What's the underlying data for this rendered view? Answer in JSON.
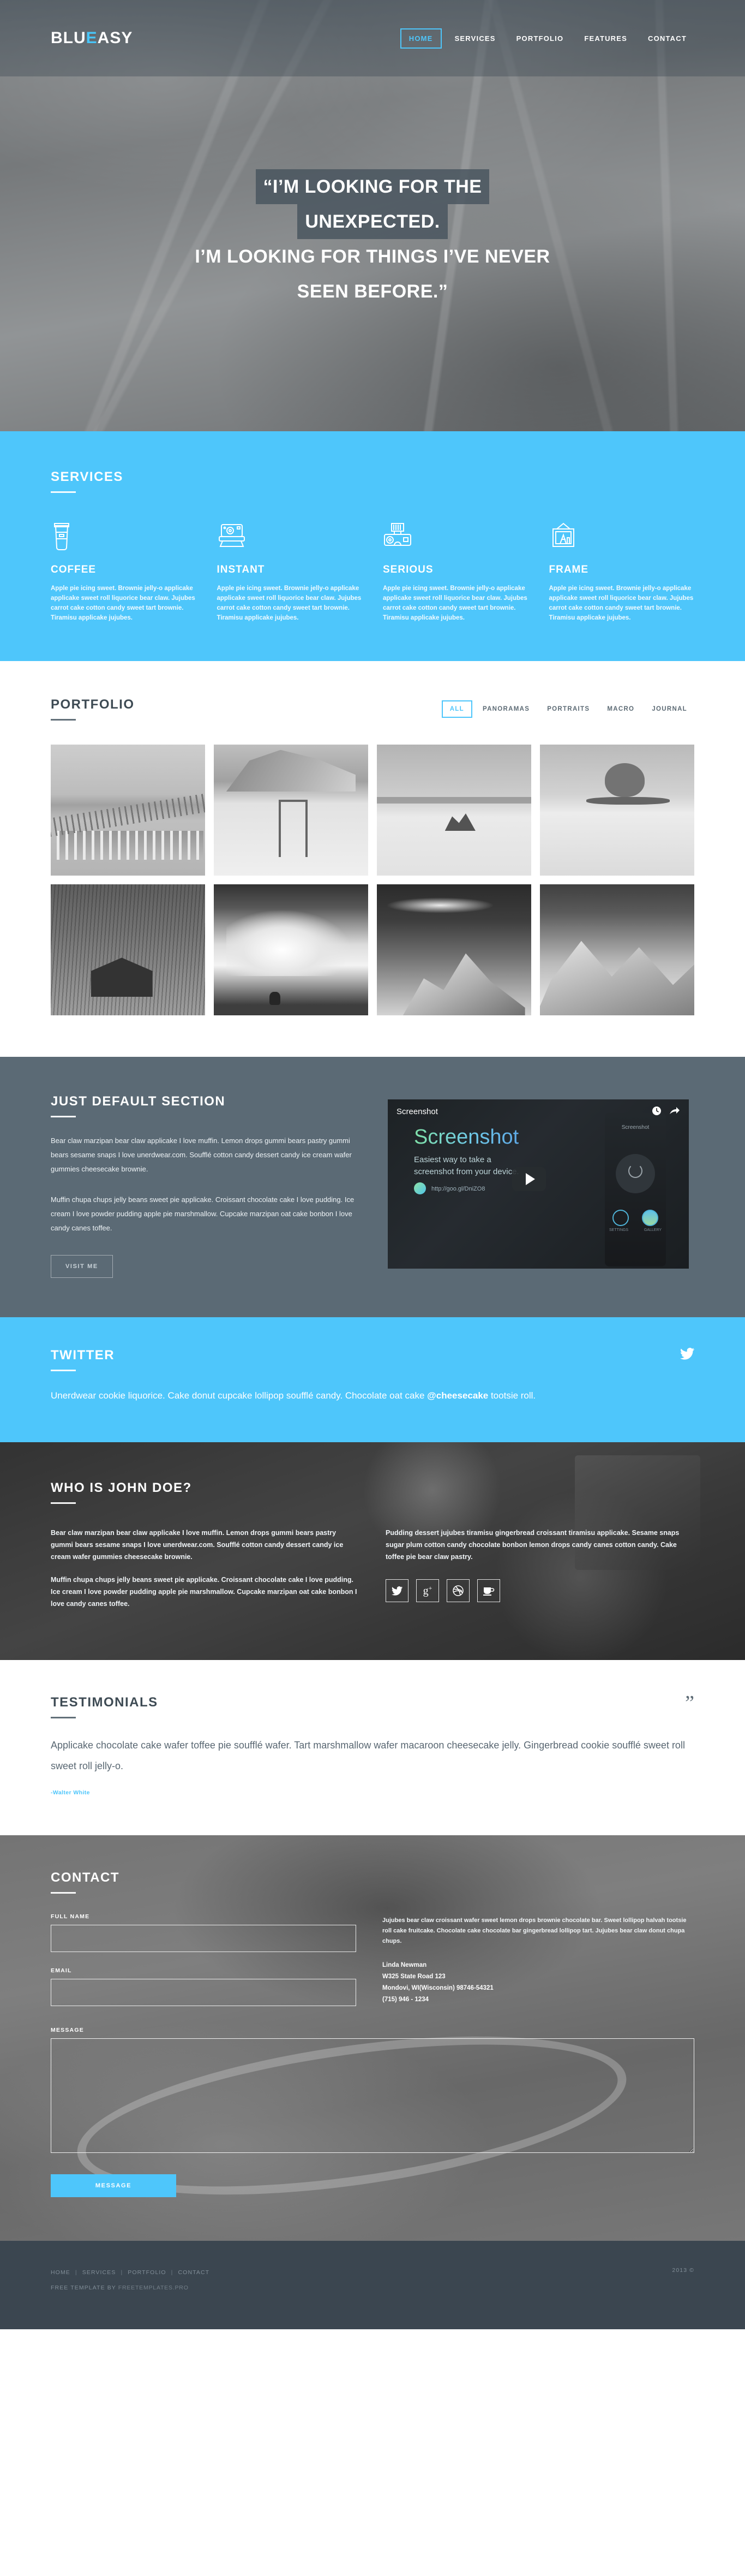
{
  "brand": {
    "prefix": "BLU",
    "highlight": "E",
    "suffix": "ASY",
    "accent": "#4ec6fb"
  },
  "nav": {
    "items": [
      {
        "label": "HOME",
        "active": true
      },
      {
        "label": "SERVICES",
        "active": false
      },
      {
        "label": "PORTFOLIO",
        "active": false
      },
      {
        "label": "FEATURES",
        "active": false
      },
      {
        "label": "CONTACT",
        "active": false
      }
    ]
  },
  "hero": {
    "line1": "“I’M LOOKING FOR THE",
    "line2": "UNEXPECTED.",
    "line3": "I’M LOOKING FOR THINGS I’VE NEVER",
    "line4": "SEEN BEFORE.”"
  },
  "services": {
    "title": "SERVICES",
    "items": [
      {
        "icon": "coffee-cup-icon",
        "title": "COFFEE",
        "body": "Apple pie icing sweet. Brownie jelly-o applicake applicake sweet roll liquorice bear claw. Jujubes carrot cake cotton candy sweet tart brownie. Tiramisu applicake jujubes."
      },
      {
        "icon": "instant-camera-icon",
        "title": "INSTANT",
        "body": "Apple pie icing sweet. Brownie jelly-o applicake applicake sweet roll liquorice bear claw. Jujubes carrot cake cotton candy sweet tart brownie. Tiramisu applicake jujubes."
      },
      {
        "icon": "dslr-camera-icon",
        "title": "SERIOUS",
        "body": "Apple pie icing sweet. Brownie jelly-o applicake applicake sweet roll liquorice bear claw. Jujubes carrot cake cotton candy sweet tart brownie. Tiramisu applicake jujubes."
      },
      {
        "icon": "picture-frame-icon",
        "title": "FRAME",
        "body": "Apple pie icing sweet. Brownie jelly-o applicake applicake sweet roll liquorice bear claw. Jujubes carrot cake cotton candy sweet tart brownie. Tiramisu applicake jujubes."
      }
    ]
  },
  "portfolio": {
    "title": "PORTFOLIO",
    "filters": [
      {
        "label": "ALL",
        "active": true
      },
      {
        "label": "PANORAMAS",
        "active": false
      },
      {
        "label": "PORTRAITS",
        "active": false
      },
      {
        "label": "MACRO",
        "active": false
      },
      {
        "label": "JOURNAL",
        "active": false
      }
    ],
    "items": [
      {
        "name": "curved-pier-over-water",
        "style": "ph-pier"
      },
      {
        "name": "golden-gate-bridge-in-fog",
        "style": "ph-bridge"
      },
      {
        "name": "lone-rock-in-calm-sea",
        "style": "ph-rock"
      },
      {
        "name": "tree-on-small-island",
        "style": "ph-tree"
      },
      {
        "name": "wooden-cabin-in-forest",
        "style": "ph-cabin"
      },
      {
        "name": "surfer-under-big-wave",
        "style": "ph-surf"
      },
      {
        "name": "snowy-mountain-peak",
        "style": "ph-peak"
      },
      {
        "name": "snow-covered-mountain-range",
        "style": "ph-range"
      }
    ]
  },
  "default_section": {
    "title": "JUST DEFAULT SECTION",
    "paragraph1": "Bear claw marzipan bear claw applicake I love muffin. Lemon drops gummi bears pastry gummi bears sesame snaps I love unerdwear.com. Soufflé cotton candy dessert candy ice cream wafer gummies cheesecake brownie.",
    "paragraph2": "Muffin chupa chups jelly beans sweet pie applicake. Croissant chocolate cake I love pudding. Ice cream I love powder pudding apple pie marshmallow. Cupcake marzipan oat cake bonbon I love candy canes toffee.",
    "button": "VISIT ME",
    "video": {
      "header": "Screenshot",
      "app_name": "Screenshot",
      "tagline_line1": "Easiest way to take a",
      "tagline_line2": "screenshot from your device.",
      "url": "http://goo.gl/DniZO8",
      "phone_title": "Screenshot",
      "phone_label_left": "SETTINGS",
      "phone_label_right": "GALLERY"
    }
  },
  "twitter": {
    "title": "TWITTER",
    "text_before": "Unerdwear cookie liquorice. Cake donut cupcake lollipop soufflé candy. Chocolate oat cake ",
    "handle": "@cheesecake",
    "text_after": " tootsie roll."
  },
  "about": {
    "title": "WHO IS JOHN DOE?",
    "left_p1": "Bear claw marzipan bear claw applicake I love muffin. Lemon drops gummi bears pastry gummi bears sesame snaps I love unerdwear.com. Soufflé cotton candy dessert candy ice cream wafer gummies cheesecake brownie.",
    "left_p2": "Muffin chupa chups jelly beans sweet pie applicake. Croissant chocolate cake I love pudding. Ice cream I love powder pudding apple pie marshmallow. Cupcake marzipan oat cake bonbon I love candy canes toffee.",
    "right_p1": "Pudding dessert jujubes tiramisu gingerbread croissant tiramisu applicake. Sesame snaps sugar plum cotton candy chocolate bonbon lemon drops candy canes cotton candy. Cake toffee pie bear claw pastry.",
    "socials": [
      {
        "name": "twitter-icon",
        "glyph": "🐦"
      },
      {
        "name": "google-plus-icon",
        "glyph": "g+"
      },
      {
        "name": "dribbble-icon",
        "glyph": "◎"
      },
      {
        "name": "coffee-cup-icon",
        "glyph": "☕"
      }
    ]
  },
  "testimonials": {
    "title": "TESTIMONIALS",
    "quote": "Applicake chocolate cake wafer toffee pie soufflé wafer. Tart marshmallow wafer macaroon cheesecake jelly. Gingerbread cookie soufflé sweet roll sweet roll jelly-o.",
    "author": "-Walter White",
    "quote_mark": "”"
  },
  "contact": {
    "title": "CONTACT",
    "fullname_label": "FULL NAME",
    "fullname_value": "",
    "fullname_placeholder": "",
    "email_label": "EMAIL",
    "email_value": "",
    "email_placeholder": "",
    "message_label": "MESSAGE",
    "message_value": "",
    "message_placeholder": "",
    "submit_label": "MESSAGE",
    "blurb": "Jujubes bear claw croissant wafer sweet lemon drops brownie chocolate bar. Sweet lollipop halvah tootsie roll cake fruitcake. Chocolate cake chocolate bar gingerbread lollipop tart. Jujubes bear claw donut chupa chups.",
    "address": {
      "name": "Linda Newman",
      "street": "W325 State Road 123",
      "city": "Mondovi, WI(Wisconsin) 98746-54321",
      "phone": "(715) 946 - 1234"
    }
  },
  "footer": {
    "links": [
      "HOME",
      "SERVICES",
      "PORTFOLIO",
      "CONTACT"
    ],
    "copyright": "2013 ©",
    "credit_prefix": "Free Template by ",
    "credit_name": "FREETEMPLATES.PRO"
  }
}
